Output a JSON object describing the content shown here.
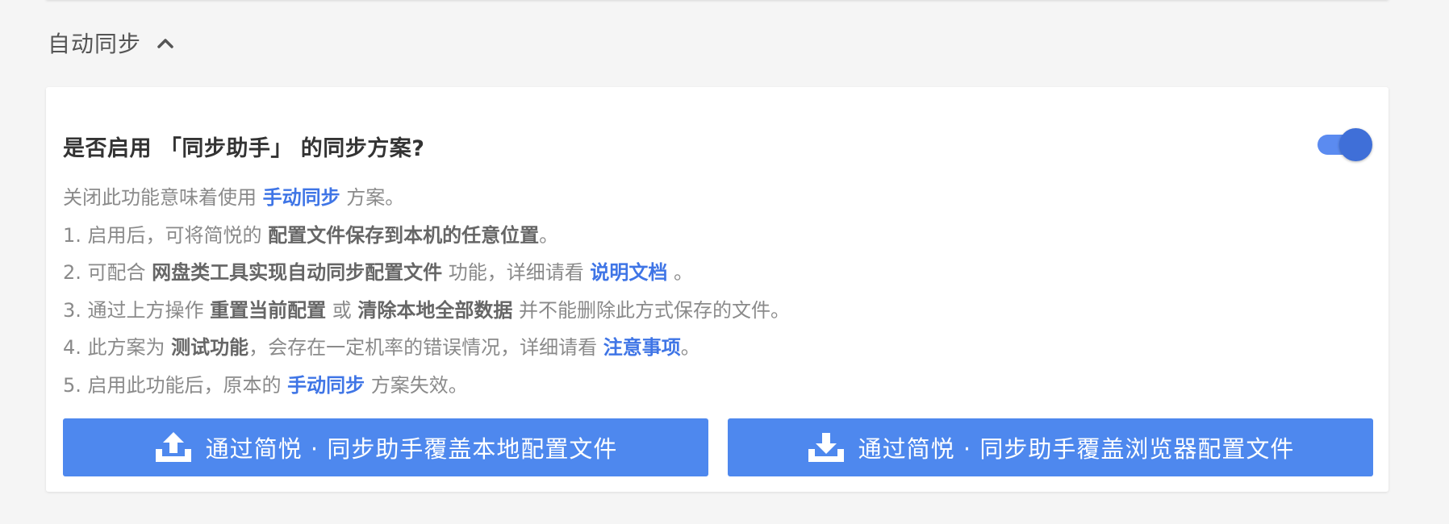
{
  "section": {
    "title": "自动同步"
  },
  "card": {
    "title": "是否启用 「同步助手」 的同步方案?",
    "toggle_on": true
  },
  "description": {
    "intro": {
      "before": "关闭此功能意味着使用 ",
      "link": "手动同步",
      "after": " 方案。"
    },
    "item1": {
      "before": "1. 启用后，可将简悦的 ",
      "bold": "配置文件保存到本机的任意位置",
      "after": "。"
    },
    "item2": {
      "before": "2. 可配合 ",
      "bold": "网盘类工具实现自动同步配置文件",
      "middle": " 功能，详细请看 ",
      "link": "说明文档",
      "after": " 。"
    },
    "item3": {
      "before": "3. 通过上方操作 ",
      "bold1": "重置当前配置",
      "middle": " 或 ",
      "bold2": "清除本地全部数据",
      "after": " 并不能删除此方式保存的文件。"
    },
    "item4": {
      "before": "4. 此方案为 ",
      "bold": "测试功能",
      "middle": "，会存在一定机率的错误情况，详细请看 ",
      "link": "注意事项",
      "after": "。"
    },
    "item5": {
      "before": "5. 启用此功能后，原本的 ",
      "link": "手动同步",
      "after": " 方案失效。"
    }
  },
  "buttons": {
    "upload_label": "通过简悦 · 同步助手覆盖本地配置文件",
    "download_label": "通过简悦 · 同步助手覆盖浏览器配置文件"
  },
  "icons": {
    "chevron": "chevron-up-icon",
    "upload": "upload-icon",
    "download": "download-icon"
  },
  "colors": {
    "accent": "#4e88ee",
    "link": "#3f75e6",
    "toggle_track": "#5b8bf0",
    "toggle_knob": "#3f6fd8"
  }
}
